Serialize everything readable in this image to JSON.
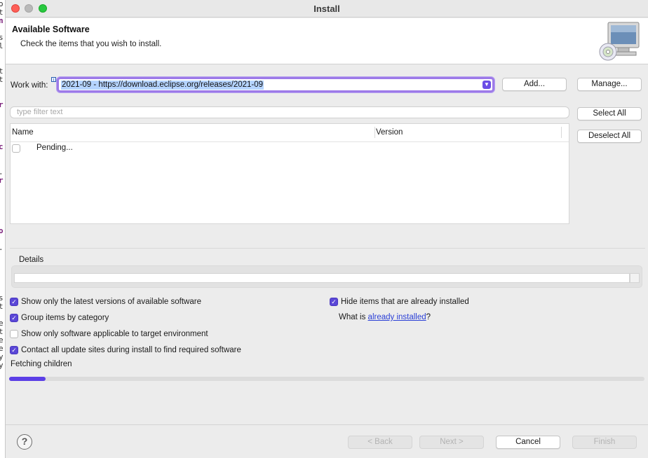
{
  "window": {
    "title": "Install"
  },
  "header": {
    "title": "Available Software",
    "description": "Check the items that you wish to install."
  },
  "work_with": {
    "label": "Work with:",
    "value": "2021-09 - https://download.eclipse.org/releases/2021-09"
  },
  "buttons": {
    "add": "Add...",
    "manage": "Manage...",
    "select_all": "Select All",
    "deselect_all": "Deselect All",
    "back": "< Back",
    "next": "Next >",
    "cancel": "Cancel",
    "finish": "Finish"
  },
  "filter": {
    "placeholder": "type filter text"
  },
  "table": {
    "columns": [
      "Name",
      "Version"
    ],
    "rows": [
      {
        "name": "Pending...",
        "version": "",
        "checked": false
      }
    ]
  },
  "details": {
    "label": "Details"
  },
  "options": {
    "latest_versions": {
      "label": "Show only the latest versions of available software",
      "checked": true
    },
    "group_by_category": {
      "label": "Group items by category",
      "checked": true
    },
    "target_env": {
      "label": "Show only software applicable to target environment",
      "checked": false
    },
    "contact_sites": {
      "label": "Contact all update sites during install to find required software",
      "checked": true
    },
    "hide_installed": {
      "label": "Hide items that are already installed",
      "checked": true
    },
    "what_is_prefix": "What is ",
    "what_is_link": "already installed",
    "what_is_suffix": "?"
  },
  "status": {
    "text": "Fetching children",
    "progress_percent": 5.7
  },
  "colors": {
    "accent": "#5b3fe6",
    "link": "#2a3fd6",
    "selection": "#b5d4ff"
  },
  "icons": {
    "banner": "computer-cd-icon",
    "help": "help-icon",
    "combo_arrow": "chevron-down-icon",
    "info": "info-icon"
  }
}
